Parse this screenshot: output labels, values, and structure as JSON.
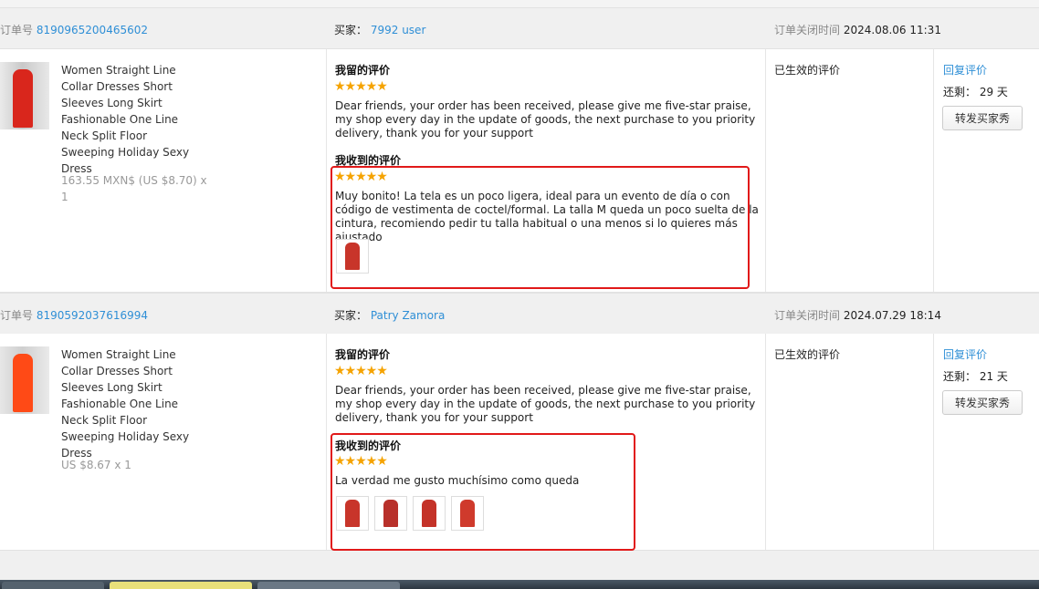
{
  "orders": [
    {
      "order_no_label": "订单号",
      "order_no": "8190965200465602",
      "buyer_label": "买家：",
      "buyer": "7992 user",
      "closed_label": "订单关闭时间",
      "closed_time": "2024.08.06 11:31",
      "product_title": "Women Straight Line Collar Dresses Short Sleeves Long Skirt Fashionable One Line Neck Split Floor Sweeping Holiday Sexy Dress",
      "price": "163.55 MXN$ (US $8.70) x 1",
      "left_review_label": "我留的评价",
      "left_rating": 5,
      "left_stars": "★★★★★",
      "left_review_text": "Dear friends, your order has been received, please give me five-star praise, my shop every day in the update of goods, the next purchase to you priority delivery, thank you for your support",
      "received_review_label": "我收到的评价",
      "received_rating": 5,
      "received_stars": "★★★★★",
      "received_review_text": "Muy bonito! La tela es un poco ligera, ideal para un evento de día o con código de vestimenta de coctel/formal. La talla M queda un poco suelta de la cintura, recomiendo pedir tu talla habitual o una menos si lo quieres más ajustado",
      "status": "已生效的评价",
      "reply_link": "回复评价",
      "remaining_label": "还剩：",
      "remaining_value": "29 天",
      "forward_button": "转发买家秀"
    },
    {
      "order_no_label": "订单号",
      "order_no": "8190592037616994",
      "buyer_label": "买家：",
      "buyer": "Patry Zamora",
      "closed_label": "订单关闭时间",
      "closed_time": "2024.07.29 18:14",
      "product_title": "Women Straight Line Collar Dresses Short Sleeves Long Skirt Fashionable One Line Neck Split Floor Sweeping Holiday Sexy Dress",
      "price": "US $8.67 x 1",
      "left_review_label": "我留的评价",
      "left_rating": 5,
      "left_stars": "★★★★★",
      "left_review_text": "Dear friends, your order has been received, please give me five-star praise, my shop every day in the update of goods, the next purchase to you priority delivery, thank you for your support",
      "received_review_label": "我收到的评价",
      "received_rating": 5,
      "received_stars": "★★★★★",
      "received_review_text": "La verdad me gusto muchísimo como queda",
      "status": "已生效的评价",
      "reply_link": "回复评价",
      "remaining_label": "还剩：",
      "remaining_value": "21 天",
      "forward_button": "转发买家秀"
    }
  ],
  "colors": {
    "link": "#2f8fd6",
    "star": "#f5a300",
    "highlight_box": "#e11919",
    "dress_red_1": "#d9261c",
    "dress_red_2": "#ff4a16"
  }
}
